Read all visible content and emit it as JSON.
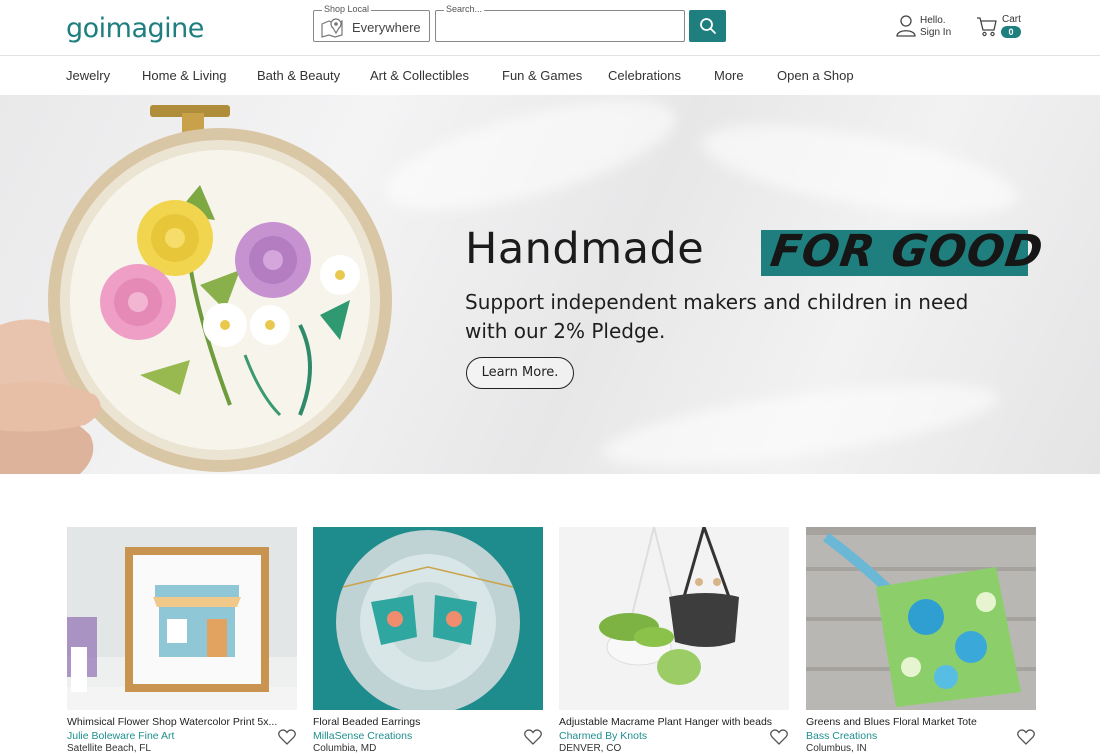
{
  "header": {
    "logo": "goimagine",
    "shop_local": {
      "legend": "Shop Local",
      "value": "Everywhere"
    },
    "search": {
      "legend": "Search...",
      "value": ""
    },
    "account": {
      "line1": "Hello.",
      "line2": "Sign In"
    },
    "cart": {
      "label": "Cart",
      "count": "0"
    }
  },
  "nav": {
    "items": [
      "Jewelry",
      "Home & Living",
      "Bath & Beauty",
      "Art & Collectibles",
      "Fun & Games",
      "Celebrations",
      "More",
      "Open a Shop"
    ]
  },
  "hero": {
    "title": "Handmade",
    "tag": "FOR GOOD",
    "subtitle_line1": "Support independent makers and children in need",
    "subtitle_line2": "with our 2% Pledge.",
    "button": "Learn More."
  },
  "products": [
    {
      "title": "Whimsical Flower Shop Watercolor Print 5x...",
      "shop": "Julie Boleware Fine Art",
      "location": "Satellite Beach, FL"
    },
    {
      "title": "Floral Beaded Earrings",
      "shop": "MillaSense Creations",
      "location": "Columbia, MD"
    },
    {
      "title": "Adjustable Macrame Plant Hanger with beads",
      "shop": "Charmed By Knots",
      "location": "DENVER, CO"
    },
    {
      "title": "Greens and Blues Floral Market Tote",
      "shop": "Bass Creations",
      "location": "Columbus, IN"
    }
  ],
  "colors": {
    "accent": "#1f7f7f",
    "shop_link": "#1f8f8f"
  },
  "icons": {
    "search": "search-icon",
    "user": "user-icon",
    "cart": "cart-icon",
    "map": "map-pin-icon",
    "favorite": "heart-icon"
  }
}
